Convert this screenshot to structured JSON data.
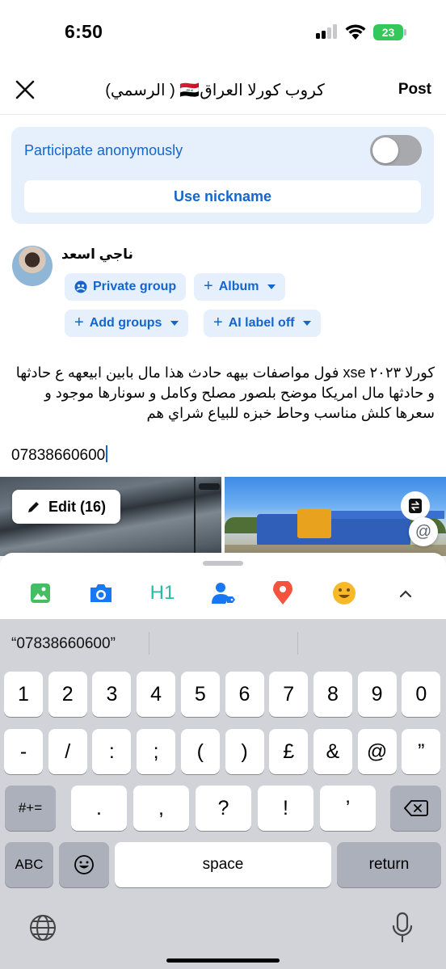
{
  "status": {
    "time": "6:50",
    "battery": "23"
  },
  "header": {
    "title": "كروب كورلا العراق🇮🇶 ( الرسمي)",
    "post_label": "Post"
  },
  "anonymous": {
    "label": "Participate anonymously",
    "toggle_on": false,
    "nickname_label": "Use nickname"
  },
  "author": {
    "name": "ناجي اسعد"
  },
  "chips": {
    "privacy": "Private group",
    "album": "Album",
    "add_groups": "Add groups",
    "ai_label": "AI label off"
  },
  "post": {
    "text": "كورلا ٢٠٢٣ xse فول مواصفات بيهه حادث هذا مال بابين ابيعهه ع حادثها و حادثها مال امريكا موضح بلصور مصلح وكامل و سونارها موجود و سعرها كلش مناسب وحاط خبزه للبياع شراي هم",
    "phone": "07838660600"
  },
  "media": {
    "edit_label": "Edit (16)",
    "mention_symbol": "@"
  },
  "tools": [
    "photo-icon",
    "camera-icon",
    "heading-icon",
    "tag-people-icon",
    "location-icon",
    "feeling-icon",
    "chevron-up-icon"
  ],
  "tools_text": {
    "heading": "H1"
  },
  "keyboard": {
    "suggestion": "“07838660600”",
    "row1": [
      "1",
      "2",
      "3",
      "4",
      "5",
      "6",
      "7",
      "8",
      "9",
      "0"
    ],
    "row2": [
      "-",
      "/",
      ":",
      ";",
      "(",
      ")",
      "£",
      "&",
      "@",
      "”"
    ],
    "row3_left": "#+=",
    "row3": [
      ".",
      ",",
      "?",
      "!",
      "’"
    ],
    "abc": "ABC",
    "space": "space",
    "return": "return"
  }
}
